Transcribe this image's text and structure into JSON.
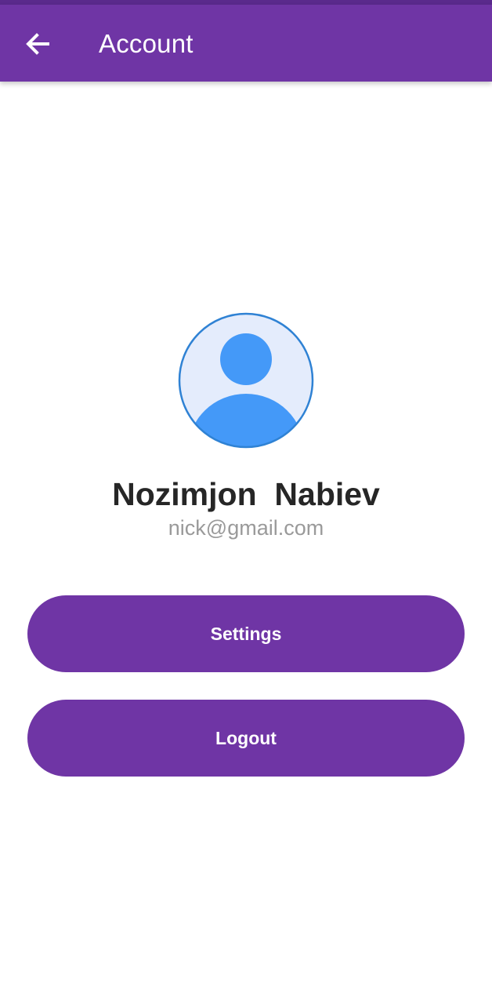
{
  "app_bar": {
    "title": "Account",
    "back_icon": "arrow-left-icon",
    "color": "#6f35a5"
  },
  "profile": {
    "avatar_icon": "person-avatar-icon",
    "name": "Nozimjon  Nabiev",
    "email": "nick@gmail.com"
  },
  "actions": {
    "settings_label": "Settings",
    "logout_label": "Logout"
  },
  "colors": {
    "primary": "#6f35a5",
    "avatar_fill": "#4499f8",
    "avatar_bg": "#e4ecfc",
    "avatar_border": "#2f82d4"
  }
}
